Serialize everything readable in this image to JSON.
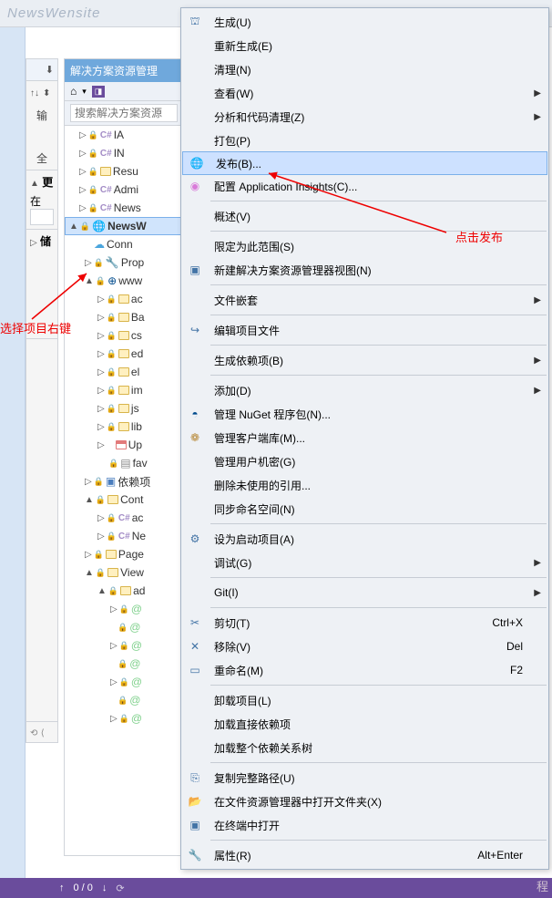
{
  "window": {
    "title_fragment": "NewsWensite"
  },
  "annotations": {
    "click_publish": "点击发布",
    "right_click_project": "选择项目右键"
  },
  "solution_panel": {
    "tab": "解决方案资源管理",
    "search_placeholder": "搜索解决方案资源"
  },
  "left_strip": {
    "input_label": "输",
    "all_label": "全",
    "section_update": "更",
    "section_storage": "储",
    "substore": "在"
  },
  "tree": {
    "n0": "IA",
    "n1": "IN",
    "n2": "Resu",
    "n3": "Admi",
    "n4": "News",
    "n5": "NewsW",
    "n6": "Conn",
    "n7": "Prop",
    "n8": "www",
    "n9": "ac",
    "n10": "Ba",
    "n11": "cs",
    "n12": "ed",
    "n13": "el",
    "n14": "im",
    "n15": "js",
    "n16": "lib",
    "n17": "Up",
    "n18": "fav",
    "n19": "依赖项",
    "n20": "Cont",
    "n21": "ac",
    "n22": "Ne",
    "n23": "Page",
    "n24": "View",
    "n25": "ad"
  },
  "context_menu": {
    "build": "生成(U)",
    "rebuild": "重新生成(E)",
    "clean": "清理(N)",
    "view": "查看(W)",
    "analyze": "分析和代码清理(Z)",
    "pack": "打包(P)",
    "publish": "发布(B)...",
    "app_insights": "配置 Application Insights(C)...",
    "overview": "概述(V)",
    "scope": "限定为此范围(S)",
    "new_explorer": "新建解决方案资源管理器视图(N)",
    "nesting": "文件嵌套",
    "edit_proj": "编辑项目文件",
    "build_deps": "生成依赖项(B)",
    "add": "添加(D)",
    "nuget": "管理 NuGet 程序包(N)...",
    "client_lib": "管理客户端库(M)...",
    "user_secrets": "管理用户机密(G)",
    "remove_unused": "删除未使用的引用...",
    "sync_ns": "同步命名空间(N)",
    "startup": "设为启动项目(A)",
    "debug": "调试(G)",
    "git": "Git(I)",
    "cut": "剪切(T)",
    "cut_key": "Ctrl+X",
    "remove": "移除(V)",
    "remove_key": "Del",
    "rename": "重命名(M)",
    "rename_key": "F2",
    "unload": "卸载项目(L)",
    "load_direct": "加载直接依赖项",
    "load_tree": "加载整个依赖关系树",
    "copy_path": "复制完整路径(U)",
    "open_explorer": "在文件资源管理器中打开文件夹(X)",
    "open_terminal": "在终端中打开",
    "properties": "属性(R)",
    "properties_key": "Alt+Enter"
  },
  "status": {
    "counter": "0 / 0"
  },
  "watermark": "程"
}
